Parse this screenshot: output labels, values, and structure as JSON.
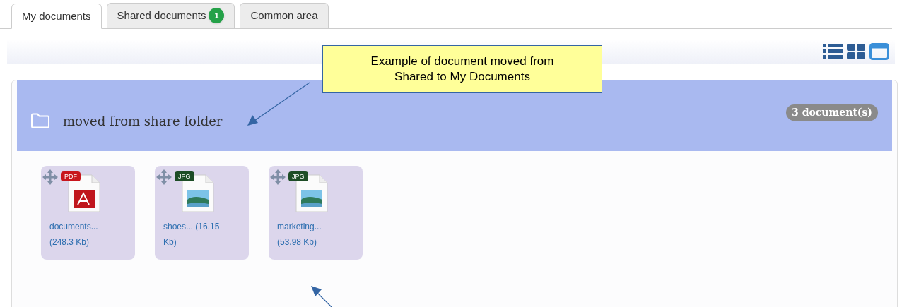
{
  "tabs": [
    {
      "label": "My documents",
      "selected": true
    },
    {
      "label": "Shared documents",
      "selected": false,
      "badge": "1"
    },
    {
      "label": "Common area",
      "selected": false
    }
  ],
  "view_buttons": [
    {
      "kind": "list",
      "selected": false
    },
    {
      "kind": "grid",
      "selected": false
    },
    {
      "kind": "window",
      "selected": true
    }
  ],
  "folder": {
    "name": "moved from share folder",
    "count": "3 document(s)",
    "documents": [
      {
        "kind": "pdf",
        "type_label": "PDF",
        "name": "documents... (248.3 Kb)"
      },
      {
        "kind": "jpg",
        "type_label": "JPG",
        "name": "shoes... (16.15 Kb)"
      },
      {
        "kind": "jpg",
        "type_label": "JPG",
        "name": "marketing... (53.98 Kb)"
      }
    ]
  },
  "annotation": "Example of document moved from Shared to My Documents"
}
